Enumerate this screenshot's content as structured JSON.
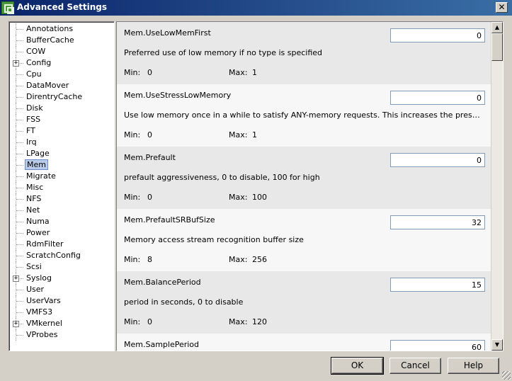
{
  "window": {
    "title": "Advanced Settings",
    "close_glyph": "✕"
  },
  "tree": {
    "items": [
      {
        "label": "Annotations",
        "expandable": false,
        "selected": false
      },
      {
        "label": "BufferCache",
        "expandable": false,
        "selected": false
      },
      {
        "label": "COW",
        "expandable": false,
        "selected": false
      },
      {
        "label": "Config",
        "expandable": true,
        "selected": false
      },
      {
        "label": "Cpu",
        "expandable": false,
        "selected": false
      },
      {
        "label": "DataMover",
        "expandable": false,
        "selected": false
      },
      {
        "label": "DirentryCache",
        "expandable": false,
        "selected": false
      },
      {
        "label": "Disk",
        "expandable": false,
        "selected": false
      },
      {
        "label": "FSS",
        "expandable": false,
        "selected": false
      },
      {
        "label": "FT",
        "expandable": false,
        "selected": false
      },
      {
        "label": "Irq",
        "expandable": false,
        "selected": false
      },
      {
        "label": "LPage",
        "expandable": false,
        "selected": false
      },
      {
        "label": "Mem",
        "expandable": false,
        "selected": true
      },
      {
        "label": "Migrate",
        "expandable": false,
        "selected": false
      },
      {
        "label": "Misc",
        "expandable": false,
        "selected": false
      },
      {
        "label": "NFS",
        "expandable": false,
        "selected": false
      },
      {
        "label": "Net",
        "expandable": false,
        "selected": false
      },
      {
        "label": "Numa",
        "expandable": false,
        "selected": false
      },
      {
        "label": "Power",
        "expandable": false,
        "selected": false
      },
      {
        "label": "RdmFilter",
        "expandable": false,
        "selected": false
      },
      {
        "label": "ScratchConfig",
        "expandable": false,
        "selected": false
      },
      {
        "label": "Scsi",
        "expandable": false,
        "selected": false
      },
      {
        "label": "Syslog",
        "expandable": true,
        "selected": false
      },
      {
        "label": "User",
        "expandable": false,
        "selected": false
      },
      {
        "label": "UserVars",
        "expandable": false,
        "selected": false
      },
      {
        "label": "VMFS3",
        "expandable": false,
        "selected": false
      },
      {
        "label": "VMkernel",
        "expandable": true,
        "selected": false
      },
      {
        "label": "VProbes",
        "expandable": false,
        "selected": false
      }
    ]
  },
  "settings": {
    "min_label": "Min:",
    "max_label": "Max:",
    "rows": [
      {
        "name": "Mem.UseLowMemFirst",
        "value": "0",
        "description": "Preferred use of low memory if no type is specified",
        "min": "0",
        "max": "1"
      },
      {
        "name": "Mem.UseStressLowMemory",
        "value": "0",
        "description": "Use low memory once in a while to satisfy ANY-memory requests. This increases the pressure on low...",
        "min": "0",
        "max": "1"
      },
      {
        "name": "Mem.Prefault",
        "value": "0",
        "description": "prefault aggressiveness, 0 to disable, 100 for high",
        "min": "0",
        "max": "100"
      },
      {
        "name": "Mem.PrefaultSRBufSize",
        "value": "32",
        "description": "Memory access stream recognition buffer size",
        "min": "8",
        "max": "256"
      },
      {
        "name": "Mem.BalancePeriod",
        "value": "15",
        "description": "period in seconds, 0 to disable",
        "min": "0",
        "max": "120"
      },
      {
        "name": "Mem.SamplePeriod",
        "value": "60",
        "description": "",
        "min": "",
        "max": ""
      }
    ]
  },
  "scrollbar": {
    "up_glyph": "▲",
    "down_glyph": "▼"
  },
  "buttons": {
    "ok": "OK",
    "cancel": "Cancel",
    "help": "Help"
  }
}
